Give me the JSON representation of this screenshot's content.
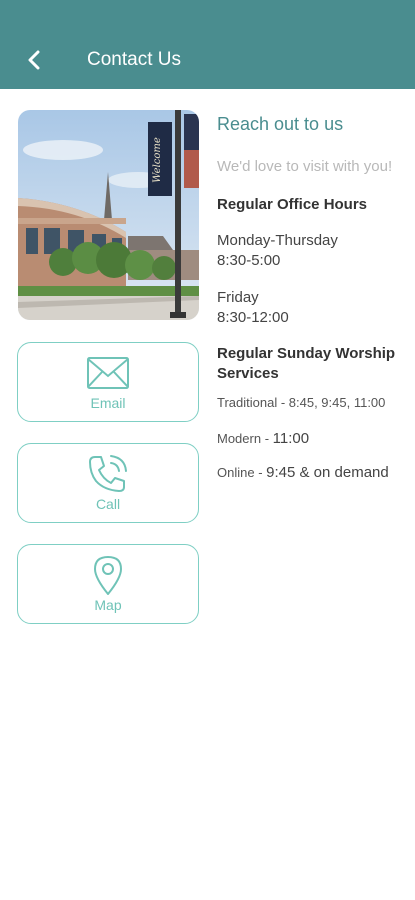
{
  "header": {
    "title": "Contact Us",
    "back_icon": "chevron-left-icon",
    "background_color": "#4a8d8f"
  },
  "contact_buttons": [
    {
      "label": "Email",
      "icon": "envelope-icon"
    },
    {
      "label": "Call",
      "icon": "phone-icon"
    },
    {
      "label": "Map",
      "icon": "map-pin-icon"
    }
  ],
  "info": {
    "heading": "Reach out to us",
    "subheading": "We'd love to visit with you!",
    "office_hours_title": "Regular Office Hours",
    "weekday_days": "Monday-Thursday",
    "weekday_hours": "8:30-5:00",
    "friday_day": "Friday",
    "friday_hours": "8:30-12:00",
    "worship_title": "Regular Sunday Worship Services",
    "traditional_label": "Traditional - 8:45, 9:45, 11:00",
    "modern_label": "Modern - ",
    "modern_time": "11:00",
    "online_label": "Online - ",
    "online_time": "9:45 & on demand"
  },
  "photo": {
    "banner_text": "Welcome"
  },
  "colors": {
    "accent": "#4a8d8f",
    "button_border": "#7fcfc4",
    "button_text": "#6fc3b7"
  }
}
